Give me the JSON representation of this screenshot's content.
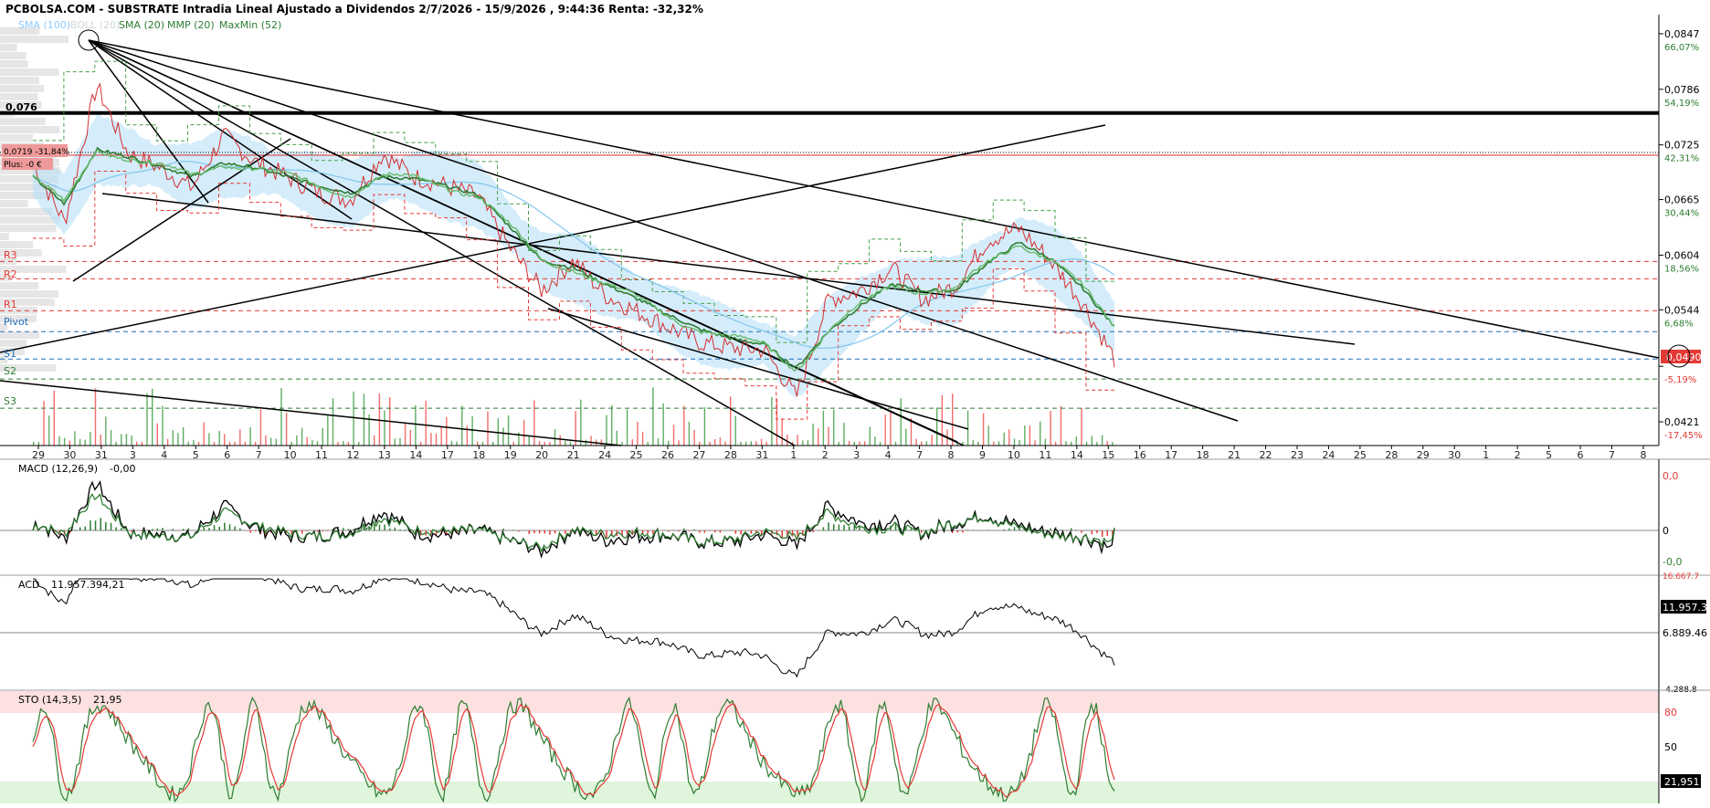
{
  "header": {
    "title": "PCBOLSA.COM - SUBSTRATE Intradia Lineal Ajustado a Dividendos 2/7/2026 - 15/9/2026 , 9:44:36 Renta: -32,32%",
    "legend_sma100": "SMA (100)",
    "legend_boll": "BOLL (20)",
    "legend_sma20": "SMA (20)",
    "legend_mmp20": "MMP (20)",
    "legend_maxmin": "MaxMin (52)"
  },
  "price_panel": {
    "hline_label": "0,076",
    "cursor_box": "0,0719 -31,84%",
    "plus_box": "Plus: -0 €",
    "pivot_labels": [
      "R3",
      "R2",
      "R1",
      "Pivot",
      "S1",
      "S2",
      "S3"
    ],
    "y_ticks": [
      {
        "value": "0,0847",
        "pct": "66,07%"
      },
      {
        "value": "0,0786",
        "pct": "54,19%"
      },
      {
        "value": "0,0725",
        "pct": "42,31%"
      },
      {
        "value": "0,0665",
        "pct": "30,44%"
      },
      {
        "value": "0,0604",
        "pct": "18,56%"
      },
      {
        "value": "0,0544",
        "pct": "6,68%"
      },
      {
        "value": "",
        "pct": "-5,19%"
      },
      {
        "value": "0,0421",
        "pct": "-17,45%"
      }
    ],
    "last_price_tag": "0,0490",
    "x_ticks": [
      "29",
      "30",
      "31",
      "3",
      "4",
      "5",
      "6",
      "7",
      "10",
      "11",
      "12",
      "13",
      "14",
      "17",
      "18",
      "19",
      "20",
      "21",
      "24",
      "25",
      "26",
      "27",
      "28",
      "31",
      "1",
      "2",
      "3",
      "4",
      "7",
      "8",
      "9",
      "10",
      "11",
      "14",
      "15",
      "16",
      "17",
      "18",
      "21",
      "22",
      "23",
      "24",
      "25",
      "28",
      "29",
      "30",
      "1",
      "2",
      "5",
      "6",
      "7",
      "8"
    ]
  },
  "macd_panel": {
    "label": "MACD (12,26,9)",
    "value": "-0,00",
    "y_ticks": [
      "0,0",
      "0",
      "-0,0"
    ]
  },
  "acd_panel": {
    "label": "ACD",
    "value": "11.957.394,21",
    "last_tag": "11.957.3",
    "y_ticks": [
      "16.667.7",
      "6.889.46",
      "-4.288.8"
    ]
  },
  "sto_panel": {
    "label": "STO (14,3,5)",
    "value": "21,95",
    "last_tag": "21,951",
    "y_ticks": [
      "80",
      "50"
    ]
  },
  "chart_data": {
    "type": "line",
    "title": "PCBOLSA.COM - SUBSTRATE Intradia Lineal Ajustado a Dividendos 2/7/2026 - 15/9/2026 , 9:44:36 Renta: -32,32%",
    "ylim": [
      0.0395,
      0.0868
    ],
    "horizontal_levels": {
      "resistance_0076": 0.076,
      "R3": 0.0597,
      "R2": 0.0578,
      "R1": 0.0543,
      "Pivot": 0.052,
      "S1": 0.049,
      "S2": 0.0468,
      "S3": 0.0436
    },
    "series": [
      {
        "name": "Precio",
        "color": "#d32f2f",
        "x": [
          "29",
          "30",
          "31",
          "3",
          "4",
          "5",
          "6",
          "7",
          "10",
          "11",
          "12",
          "13",
          "14",
          "17",
          "18",
          "19",
          "20",
          "21",
          "24",
          "25",
          "26",
          "27",
          "28",
          "31",
          "1",
          "2",
          "3",
          "4",
          "7",
          "8",
          "9",
          "10",
          "11",
          "14",
          "15"
        ],
        "values": [
          0.0705,
          0.064,
          0.079,
          0.0715,
          0.07,
          0.0678,
          0.0735,
          0.0706,
          0.069,
          0.0672,
          0.0665,
          0.0715,
          0.069,
          0.068,
          0.0668,
          0.0612,
          0.0565,
          0.0598,
          0.056,
          0.0542,
          0.0525,
          0.0508,
          0.0502,
          0.05,
          0.0448,
          0.0555,
          0.0565,
          0.059,
          0.0555,
          0.057,
          0.062,
          0.0633,
          0.0598,
          0.0552,
          0.049
        ]
      },
      {
        "name": "SMA (20)",
        "color": "#2e7d32",
        "x": [
          "29",
          "30",
          "31",
          "3",
          "4",
          "5",
          "6",
          "7",
          "10",
          "11",
          "12",
          "13",
          "14",
          "17",
          "18",
          "19",
          "20",
          "21",
          "24",
          "25",
          "26",
          "27",
          "28",
          "31",
          "1",
          "2",
          "3",
          "4",
          "7",
          "8",
          "9",
          "10",
          "11",
          "14",
          "15"
        ],
        "values": [
          0.069,
          0.066,
          0.072,
          0.0712,
          0.0702,
          0.069,
          0.0705,
          0.07,
          0.069,
          0.068,
          0.0672,
          0.069,
          0.0688,
          0.068,
          0.067,
          0.0635,
          0.0598,
          0.059,
          0.0572,
          0.0556,
          0.0538,
          0.0522,
          0.0512,
          0.0506,
          0.048,
          0.052,
          0.0548,
          0.0572,
          0.0565,
          0.0565,
          0.0595,
          0.0618,
          0.06,
          0.0568,
          0.0525
        ]
      }
    ],
    "macd_value": -0.0,
    "acd_value": 11957394.21,
    "sto_value": 21.95
  }
}
